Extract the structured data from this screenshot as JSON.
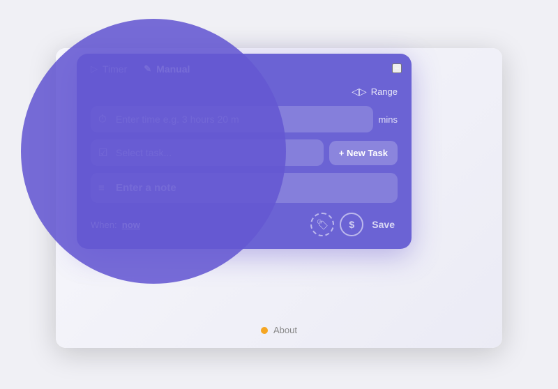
{
  "tabs": [
    {
      "id": "timer",
      "label": "Timer",
      "icon": "▷",
      "active": false
    },
    {
      "id": "manual",
      "label": "Manual",
      "icon": "✎",
      "active": true
    }
  ],
  "minimize_label": "−",
  "range_label": "Range",
  "range_icon": "◁▷",
  "time_placeholder": "Enter time e.g. 3 hours 20 m",
  "mins_label": "mins",
  "task_placeholder": "Select task...",
  "new_task_label": "+ New Task",
  "note_placeholder": "Enter a note",
  "when_label": "When:",
  "when_value": "now",
  "save_label": "Save",
  "about_label": "About",
  "icon_tag": "🏷",
  "icon_dollar": "$",
  "colors": {
    "panel_bg": "#6b63d4",
    "overlay_circle": "rgba(100,88,210,0.88)"
  }
}
